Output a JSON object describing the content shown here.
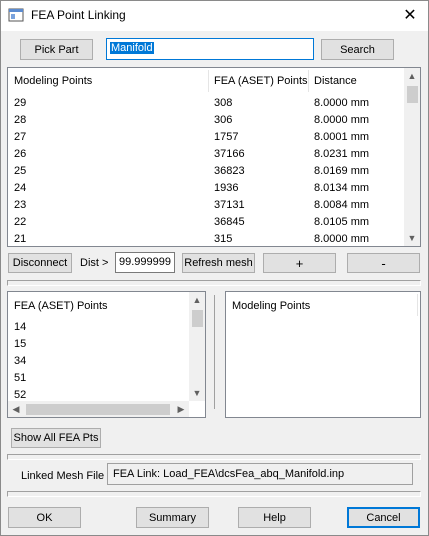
{
  "window": {
    "title": "FEA Point Linking",
    "close_glyph": "✕"
  },
  "top": {
    "pick_part_label": "Pick Part",
    "part_name_value": "Manifold",
    "search_label": "Search"
  },
  "main_table": {
    "columns": [
      "Modeling Points",
      "FEA (ASET) Points",
      "Distance"
    ],
    "rows": [
      [
        "29",
        "308",
        "8.0000 mm"
      ],
      [
        "28",
        "306",
        "8.0000 mm"
      ],
      [
        "27",
        "1757",
        "8.0001 mm"
      ],
      [
        "26",
        "37166",
        "8.0231 mm"
      ],
      [
        "25",
        "36823",
        "8.0169 mm"
      ],
      [
        "24",
        "1936",
        "8.0134 mm"
      ],
      [
        "23",
        "37131",
        "8.0084 mm"
      ],
      [
        "22",
        "36845",
        "8.0105 mm"
      ],
      [
        "21",
        "315",
        "8.0000 mm"
      ]
    ]
  },
  "mid_controls": {
    "disconnect_label": "Disconnect",
    "dist_label": "Dist >",
    "dist_value": "99.999999",
    "refresh_label": "Refresh mesh",
    "plus_label": "+",
    "minus_label": "-"
  },
  "fea_list": {
    "header": "FEA (ASET) Points",
    "items": [
      "14",
      "15",
      "34",
      "51",
      "52"
    ]
  },
  "modeling_list": {
    "header": "Modeling Points"
  },
  "show_all_label": "Show All FEA Pts",
  "linked_mesh": {
    "label": "Linked Mesh File",
    "value": "FEA Link: Load_FEA\\dcsFea_abq_Manifold.inp"
  },
  "footer": {
    "ok_label": "OK",
    "summary_label": "Summary",
    "help_label": "Help",
    "cancel_label": "Cancel"
  }
}
